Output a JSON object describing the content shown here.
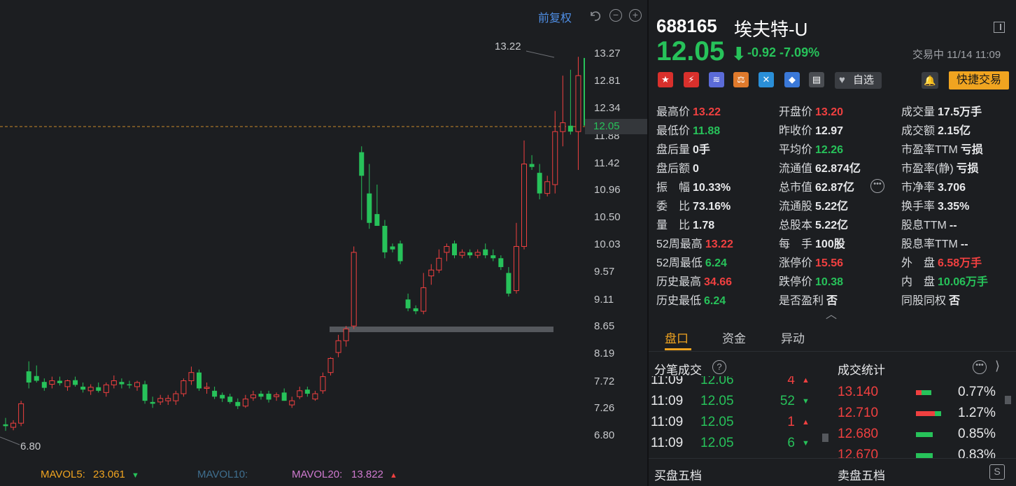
{
  "chart": {
    "toolbar": {
      "adjust_label": "前复权",
      "undo_icon": "undo-icon",
      "zoom_out_label": "−",
      "zoom_in_label": "+"
    },
    "y_axis": [
      "13.27",
      "12.81",
      "12.34",
      "11.88",
      "11.42",
      "10.96",
      "10.50",
      "10.03",
      "9.57",
      "9.11",
      "8.65",
      "8.19",
      "7.72",
      "7.26",
      "6.80"
    ],
    "current_price_tag": "12.05",
    "high_label": "13.22",
    "low_label": "6.80",
    "mavol": {
      "mavol5_label": "MAVOL5:",
      "mavol5_value": "23.061",
      "mavol10_label": "MAVOL10:",
      "mavol20_label": "MAVOL20:",
      "mavol20_value": "13.822"
    },
    "colors": {
      "up": "#f04040",
      "down": "#27c25a"
    },
    "candles": [
      {
        "o": 6.98,
        "h": 7.09,
        "l": 6.87,
        "c": 6.95
      },
      {
        "o": 6.93,
        "h": 7.05,
        "l": 6.88,
        "c": 7.0
      },
      {
        "o": 7.0,
        "h": 7.38,
        "l": 6.95,
        "c": 7.33
      },
      {
        "o": 7.88,
        "h": 8.05,
        "l": 7.59,
        "c": 7.69
      },
      {
        "o": 7.8,
        "h": 7.98,
        "l": 7.69,
        "c": 7.72
      },
      {
        "o": 7.7,
        "h": 7.76,
        "l": 7.55,
        "c": 7.6
      },
      {
        "o": 7.66,
        "h": 7.79,
        "l": 7.59,
        "c": 7.72
      },
      {
        "o": 7.72,
        "h": 7.79,
        "l": 7.64,
        "c": 7.68
      },
      {
        "o": 7.62,
        "h": 7.74,
        "l": 7.55,
        "c": 7.72
      },
      {
        "o": 7.73,
        "h": 7.79,
        "l": 7.62,
        "c": 7.65
      },
      {
        "o": 7.62,
        "h": 7.69,
        "l": 7.52,
        "c": 7.57
      },
      {
        "o": 7.55,
        "h": 7.66,
        "l": 7.48,
        "c": 7.61
      },
      {
        "o": 7.61,
        "h": 7.69,
        "l": 7.52,
        "c": 7.55
      },
      {
        "o": 7.52,
        "h": 7.69,
        "l": 7.45,
        "c": 7.65
      },
      {
        "o": 7.65,
        "h": 7.81,
        "l": 7.59,
        "c": 7.72
      },
      {
        "o": 7.7,
        "h": 7.76,
        "l": 7.59,
        "c": 7.66
      },
      {
        "o": 7.66,
        "h": 7.72,
        "l": 7.59,
        "c": 7.65
      },
      {
        "o": 7.62,
        "h": 7.72,
        "l": 7.55,
        "c": 7.69
      },
      {
        "o": 7.66,
        "h": 7.72,
        "l": 7.33,
        "c": 7.38
      },
      {
        "o": 7.36,
        "h": 7.45,
        "l": 7.26,
        "c": 7.33
      },
      {
        "o": 7.36,
        "h": 7.48,
        "l": 7.31,
        "c": 7.42
      },
      {
        "o": 7.38,
        "h": 7.48,
        "l": 7.31,
        "c": 7.42
      },
      {
        "o": 7.38,
        "h": 7.55,
        "l": 7.31,
        "c": 7.5
      },
      {
        "o": 7.5,
        "h": 7.76,
        "l": 7.45,
        "c": 7.72
      },
      {
        "o": 7.72,
        "h": 7.96,
        "l": 7.65,
        "c": 7.86
      },
      {
        "o": 7.86,
        "h": 7.91,
        "l": 7.55,
        "c": 7.59
      },
      {
        "o": 7.59,
        "h": 7.69,
        "l": 7.5,
        "c": 7.61
      },
      {
        "o": 7.55,
        "h": 7.62,
        "l": 7.41,
        "c": 7.45
      },
      {
        "o": 7.48,
        "h": 7.52,
        "l": 7.36,
        "c": 7.42
      },
      {
        "o": 7.45,
        "h": 7.5,
        "l": 7.33,
        "c": 7.36
      },
      {
        "o": 7.36,
        "h": 7.42,
        "l": 7.24,
        "c": 7.29
      },
      {
        "o": 7.29,
        "h": 7.48,
        "l": 7.26,
        "c": 7.41
      },
      {
        "o": 7.43,
        "h": 7.55,
        "l": 7.38,
        "c": 7.48
      },
      {
        "o": 7.5,
        "h": 7.55,
        "l": 7.4,
        "c": 7.45
      },
      {
        "o": 7.5,
        "h": 7.55,
        "l": 7.35,
        "c": 7.4
      },
      {
        "o": 7.45,
        "h": 7.52,
        "l": 7.38,
        "c": 7.48
      },
      {
        "o": 7.52,
        "h": 7.59,
        "l": 7.38,
        "c": 7.38
      },
      {
        "o": 7.31,
        "h": 7.45,
        "l": 7.26,
        "c": 7.38
      },
      {
        "o": 7.45,
        "h": 7.62,
        "l": 7.41,
        "c": 7.55
      },
      {
        "o": 7.57,
        "h": 7.62,
        "l": 7.45,
        "c": 7.5
      },
      {
        "o": 7.41,
        "h": 7.55,
        "l": 7.38,
        "c": 7.5
      },
      {
        "o": 7.55,
        "h": 7.86,
        "l": 7.5,
        "c": 7.79
      },
      {
        "o": 7.86,
        "h": 8.12,
        "l": 7.81,
        "c": 8.1
      },
      {
        "o": 8.2,
        "h": 8.5,
        "l": 8.12,
        "c": 8.4
      },
      {
        "o": 8.4,
        "h": 8.65,
        "l": 8.3,
        "c": 8.6
      },
      {
        "o": 8.65,
        "h": 10.0,
        "l": 8.6,
        "c": 9.9
      },
      {
        "o": 11.6,
        "h": 11.7,
        "l": 10.45,
        "c": 11.2
      },
      {
        "o": 10.9,
        "h": 11.4,
        "l": 10.3,
        "c": 10.4
      },
      {
        "o": 10.55,
        "h": 11.05,
        "l": 10.4,
        "c": 10.35
      },
      {
        "o": 10.35,
        "h": 10.45,
        "l": 9.8,
        "c": 9.9
      },
      {
        "o": 10.0,
        "h": 10.05,
        "l": 9.9,
        "c": 9.95
      },
      {
        "o": 10.05,
        "h": 10.1,
        "l": 9.7,
        "c": 9.75
      },
      {
        "o": 9.1,
        "h": 9.2,
        "l": 8.9,
        "c": 8.95
      },
      {
        "o": 8.95,
        "h": 9.0,
        "l": 8.85,
        "c": 8.9
      },
      {
        "o": 8.9,
        "h": 9.55,
        "l": 8.85,
        "c": 9.3
      },
      {
        "o": 9.5,
        "h": 9.7,
        "l": 9.35,
        "c": 9.6
      },
      {
        "o": 9.6,
        "h": 9.95,
        "l": 9.55,
        "c": 9.8
      },
      {
        "o": 9.9,
        "h": 10.05,
        "l": 9.75,
        "c": 10.0
      },
      {
        "o": 10.05,
        "h": 10.1,
        "l": 9.8,
        "c": 9.85
      },
      {
        "o": 9.85,
        "h": 9.95,
        "l": 9.8,
        "c": 9.9
      },
      {
        "o": 9.9,
        "h": 9.95,
        "l": 9.8,
        "c": 9.85
      },
      {
        "o": 9.85,
        "h": 9.95,
        "l": 9.8,
        "c": 9.9
      },
      {
        "o": 9.95,
        "h": 10.05,
        "l": 9.8,
        "c": 9.85
      },
      {
        "o": 9.85,
        "h": 9.95,
        "l": 9.75,
        "c": 9.8
      },
      {
        "o": 9.8,
        "h": 9.85,
        "l": 9.6,
        "c": 9.65
      },
      {
        "o": 9.55,
        "h": 9.65,
        "l": 9.15,
        "c": 9.2
      },
      {
        "o": 9.25,
        "h": 10.4,
        "l": 9.2,
        "c": 10.0
      },
      {
        "o": 10.0,
        "h": 11.8,
        "l": 9.95,
        "c": 11.4
      },
      {
        "o": 11.4,
        "h": 11.55,
        "l": 11.3,
        "c": 11.35
      },
      {
        "o": 11.25,
        "h": 11.4,
        "l": 10.8,
        "c": 10.9
      },
      {
        "o": 10.9,
        "h": 11.2,
        "l": 10.85,
        "c": 11.1
      },
      {
        "o": 11.05,
        "h": 12.3,
        "l": 10.9,
        "c": 11.95
      },
      {
        "o": 11.95,
        "h": 12.9,
        "l": 11.7,
        "c": 12.1
      },
      {
        "o": 12.05,
        "h": 13.0,
        "l": 11.9,
        "c": 11.95
      },
      {
        "o": 11.95,
        "h": 13.22,
        "l": 11.3,
        "c": 12.9
      },
      {
        "o": 13.2,
        "h": 13.22,
        "l": 11.88,
        "c": 12.05
      }
    ]
  },
  "quote": {
    "code": "688165",
    "name": "埃夫特-U",
    "price": "12.05",
    "arrow": "⬇",
    "change": "-0.92",
    "change_pct": "-7.09%",
    "status": "交易中 11/14 11:09",
    "watch_label": "自选",
    "watch_icon": "heart-icon",
    "bell_icon": "bell-icon",
    "quick_trade_label": "快捷交易",
    "tags": [
      {
        "icon": "china-flag-icon",
        "glyph": "★",
        "color": "#d9302c"
      },
      {
        "icon": "margin-trading-icon",
        "glyph": "⚡",
        "color": "#d9302c"
      },
      {
        "icon": "coin-stack-icon",
        "glyph": "≋",
        "color": "#5b6bd8"
      },
      {
        "icon": "scale-icon",
        "glyph": "⚖",
        "color": "#e07a2c"
      },
      {
        "icon": "connect-icon",
        "glyph": "✕",
        "color": "#2a8fd8"
      },
      {
        "icon": "price-tag-icon",
        "glyph": "◆",
        "color": "#3a78d8"
      },
      {
        "icon": "document-icon",
        "glyph": "▤",
        "color": "#4a4d52"
      }
    ]
  },
  "stats": {
    "col1": [
      {
        "k": "最高价",
        "v": "13.22",
        "c": "up"
      },
      {
        "k": "最低价",
        "v": "11.88",
        "c": "dn"
      },
      {
        "k": "盘后量",
        "v": "0手",
        "c": "wh"
      },
      {
        "k": "盘后额",
        "v": "0",
        "c": "wh"
      },
      {
        "k": "振　幅",
        "v": "10.33%",
        "c": "wh"
      },
      {
        "k": "委　比",
        "v": "73.16%",
        "c": "wh"
      },
      {
        "k": "量　比",
        "v": "1.78",
        "c": "wh"
      },
      {
        "k": "52周最高",
        "v": "13.22",
        "c": "up"
      },
      {
        "k": "52周最低",
        "v": "6.24",
        "c": "dn"
      },
      {
        "k": "历史最高",
        "v": "34.66",
        "c": "up"
      },
      {
        "k": "历史最低",
        "v": "6.24",
        "c": "dn"
      }
    ],
    "col2": [
      {
        "k": "开盘价",
        "v": "13.20",
        "c": "up"
      },
      {
        "k": "昨收价",
        "v": "12.97",
        "c": "wh"
      },
      {
        "k": "平均价",
        "v": "12.26",
        "c": "dn"
      },
      {
        "k": "流通值",
        "v": "62.874亿",
        "c": "wh"
      },
      {
        "k": "总市值",
        "v": "62.87亿",
        "c": "wh"
      },
      {
        "k": "流通股",
        "v": "5.22亿",
        "c": "wh"
      },
      {
        "k": "总股本",
        "v": "5.22亿",
        "c": "wh"
      },
      {
        "k": "每　手",
        "v": "100股",
        "c": "wh"
      },
      {
        "k": "涨停价",
        "v": "15.56",
        "c": "up"
      },
      {
        "k": "跌停价",
        "v": "10.38",
        "c": "dn"
      },
      {
        "k": "是否盈利",
        "v": "否",
        "c": "wh"
      }
    ],
    "col3": [
      {
        "k": "成交量",
        "v": "17.5万手",
        "c": "wh"
      },
      {
        "k": "成交额",
        "v": "2.15亿",
        "c": "wh"
      },
      {
        "k": "市盈率TTM",
        "v": "亏损",
        "c": "wh"
      },
      {
        "k": "市盈率(静)",
        "v": "亏损",
        "c": "wh"
      },
      {
        "k": "市净率",
        "v": "3.706",
        "c": "wh"
      },
      {
        "k": "换手率",
        "v": "3.35%",
        "c": "wh"
      },
      {
        "k": "股息TTM",
        "v": "--",
        "c": "wh"
      },
      {
        "k": "股息率TTM",
        "v": "--",
        "c": "wh"
      },
      {
        "k": "外　盘",
        "v": "6.58万手",
        "c": "up"
      },
      {
        "k": "内　盘",
        "v": "10.06万手",
        "c": "dn"
      },
      {
        "k": "同股同权",
        "v": "否",
        "c": "wh"
      }
    ],
    "more_icon": "more-icon",
    "collapse_icon": "chevron-up-icon"
  },
  "tabs": [
    {
      "label": "盘口"
    },
    {
      "label": "资金"
    },
    {
      "label": "异动"
    }
  ],
  "ticks": {
    "title": "分笔成交",
    "rows": [
      {
        "time": "11:09",
        "price": "12.06",
        "vol": "4",
        "dir": "▲",
        "c": "up"
      },
      {
        "time": "11:09",
        "price": "12.05",
        "vol": "52",
        "dir": "▼",
        "c": "dn"
      },
      {
        "time": "11:09",
        "price": "12.05",
        "vol": "1",
        "dir": "▲",
        "c": "up"
      },
      {
        "time": "11:09",
        "price": "12.05",
        "vol": "6",
        "dir": "▼",
        "c": "dn"
      }
    ]
  },
  "volume_stats": {
    "title": "成交统计",
    "rows": [
      {
        "price": "13.140",
        "pct": "0.77%",
        "buy_ratio": 0.35
      },
      {
        "price": "12.710",
        "pct": "1.27%",
        "buy_ratio": 0.75
      },
      {
        "price": "12.680",
        "pct": "0.85%",
        "buy_ratio": 0.0
      },
      {
        "price": "12.670",
        "pct": "0.83%",
        "buy_ratio": 0.0
      }
    ],
    "bar_scale_pct": 1.27
  },
  "bottom": {
    "buy5": "买盘五档",
    "sell5": "卖盘五档",
    "s_label": "S"
  }
}
